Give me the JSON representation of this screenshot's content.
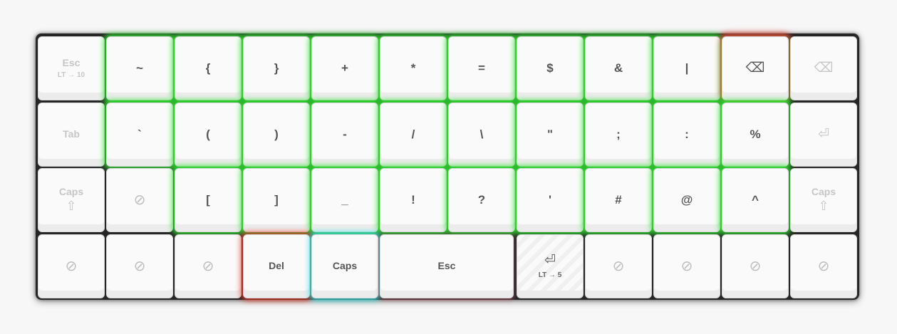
{
  "keyboard": {
    "rows": [
      [
        {
          "label": "Esc",
          "sub": "LT → 10"
        },
        {
          "label": "~"
        },
        {
          "label": "{"
        },
        {
          "label": "}"
        },
        {
          "label": "+"
        },
        {
          "label": "*"
        },
        {
          "label": "="
        },
        {
          "label": "$"
        },
        {
          "label": "&"
        },
        {
          "label": "|"
        },
        {
          "label": "⌫",
          "icon": "backspace-icon"
        },
        {
          "label": "⌫",
          "icon": "backspace-icon"
        }
      ],
      [
        {
          "label": "Tab"
        },
        {
          "label": "`"
        },
        {
          "label": "("
        },
        {
          "label": ")"
        },
        {
          "label": "-"
        },
        {
          "label": "/"
        },
        {
          "label": "\\"
        },
        {
          "label": "\""
        },
        {
          "label": ";"
        },
        {
          "label": ":"
        },
        {
          "label": "%"
        },
        {
          "label": "⏎",
          "icon": "enter-icon"
        }
      ],
      [
        {
          "label": "Caps",
          "sub": "⇧"
        },
        {
          "label": "⊘",
          "icon": "no-action-icon"
        },
        {
          "label": "["
        },
        {
          "label": "]"
        },
        {
          "label": "_"
        },
        {
          "label": "!"
        },
        {
          "label": "?"
        },
        {
          "label": "'"
        },
        {
          "label": "#"
        },
        {
          "label": "@"
        },
        {
          "label": "^"
        },
        {
          "label": "Caps",
          "sub": "⇧"
        }
      ],
      [
        {
          "label": "⊘",
          "icon": "no-action-icon"
        },
        {
          "label": "⊘",
          "icon": "no-action-icon"
        },
        {
          "label": "⊘",
          "icon": "no-action-icon"
        },
        {
          "label": "Del"
        },
        {
          "label": "Caps"
        },
        {
          "label": "Esc"
        },
        {
          "label": "⏎",
          "sub": "LT → 5",
          "icon": "enter-icon"
        },
        {
          "label": "⊘",
          "icon": "no-action-icon"
        },
        {
          "label": "⊘",
          "icon": "no-action-icon"
        },
        {
          "label": "⊘",
          "icon": "no-action-icon"
        },
        {
          "label": "⊘",
          "icon": "no-action-icon"
        }
      ]
    ],
    "colors": {
      "board": "#262626",
      "key": "#fafafa",
      "glow_green": "#32e632",
      "glow_red": "#eb3c28",
      "glow_cyan": "#3ce6e6"
    }
  }
}
